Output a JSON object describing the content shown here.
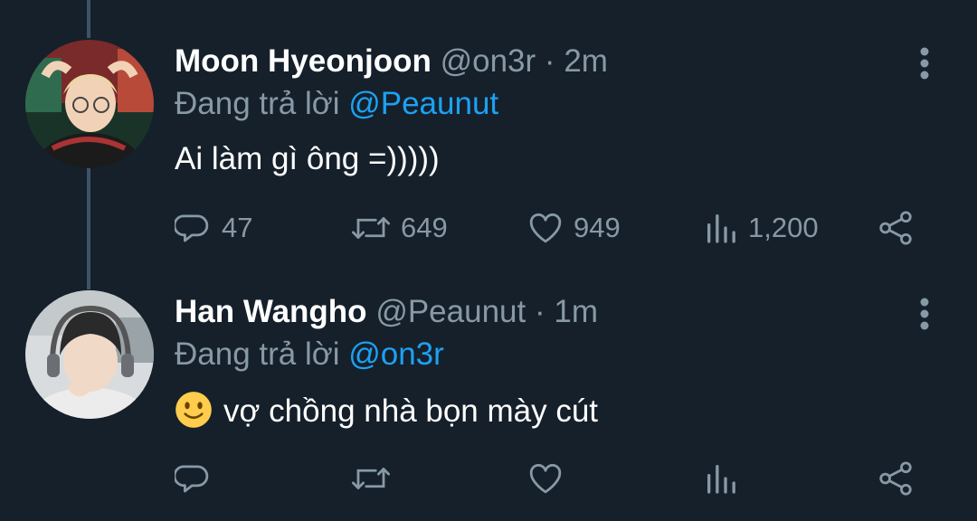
{
  "colors": {
    "background": "#15202b",
    "primary_text": "#ffffff",
    "secondary_text": "#8899a6",
    "accent": "#1da1f2",
    "thread_line": "#3d5466"
  },
  "tweets": [
    {
      "avatar_icon": "avatar-photo",
      "display_name": "Moon Hyeonjoon",
      "handle": "@on3r",
      "separator": "·",
      "time": "2m",
      "reply_prefix": "Đang trả lời",
      "reply_to": "@Peaunut",
      "text": "Ai làm gì ông =)))))",
      "emoji": "",
      "stats": {
        "replies": "47",
        "retweets": "649",
        "likes": "949",
        "views": "1,200"
      }
    },
    {
      "avatar_icon": "avatar-photo",
      "display_name": "Han Wangho",
      "handle": "@Peaunut",
      "separator": "·",
      "time": "1m",
      "reply_prefix": "Đang trả lời",
      "reply_to": "@on3r",
      "text": "vợ chồng nhà bọn mày cút",
      "emoji": "slightly-smiling-face",
      "stats": {
        "replies": "",
        "retweets": "",
        "likes": "",
        "views": ""
      }
    }
  ],
  "icons": {
    "reply": "speech-bubble-icon",
    "retweet": "retweet-icon",
    "like": "heart-icon",
    "views": "bar-chart-icon",
    "share": "share-icon",
    "more": "vertical-ellipsis-icon"
  }
}
